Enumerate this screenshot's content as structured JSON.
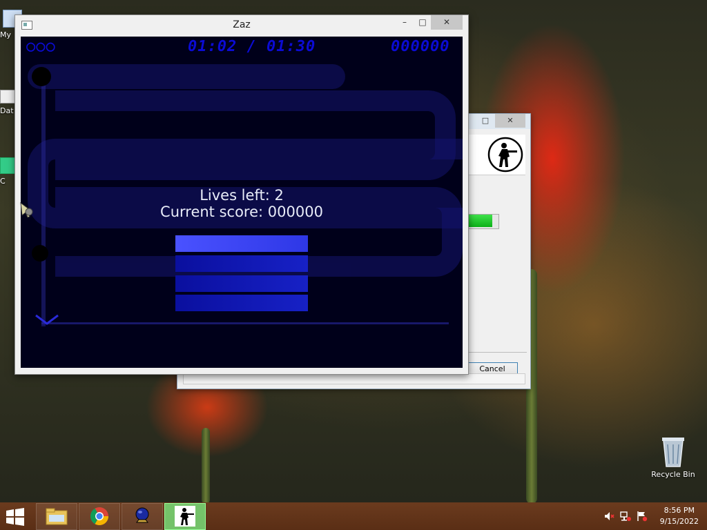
{
  "desktop": {
    "recycle_bin_label": "Recycle Bin",
    "left_labels": [
      "My",
      "Dat",
      "C"
    ]
  },
  "window_main": {
    "title": "Zaz",
    "controls": {
      "minimize": "–",
      "maximize": "□",
      "close": "✕"
    },
    "hud": {
      "left": "○○○",
      "time": "01:02 / 01:30",
      "score": "000000"
    },
    "lives_text": "Lives left: 2",
    "score_text": "Current score: 000000",
    "menu_items": [
      {
        "selected": true
      },
      {
        "selected": false
      },
      {
        "selected": false
      },
      {
        "selected": false
      }
    ]
  },
  "window_back": {
    "controls": {
      "maximize": "□",
      "close": "✕"
    },
    "progress": 0.8,
    "cancel_label": "Cancel",
    "icon": "counter-strike-soldier-icon"
  },
  "taskbar": {
    "buttons": [
      "start-icon",
      "file-explorer-icon",
      "chrome-icon",
      "orb-app-icon",
      "counter-strike-icon"
    ],
    "time": "8:56 PM",
    "date": "9/15/2022",
    "tray_icons": [
      "volume-muted-icon",
      "network-icon",
      "flag-alert-icon"
    ]
  },
  "colors": {
    "game_bg": "#00001a",
    "hud_blue": "#0b0bd4",
    "menu_selected": "#4a52ff",
    "menu_item": "#1721c6",
    "taskbar": "#5a2e15"
  }
}
